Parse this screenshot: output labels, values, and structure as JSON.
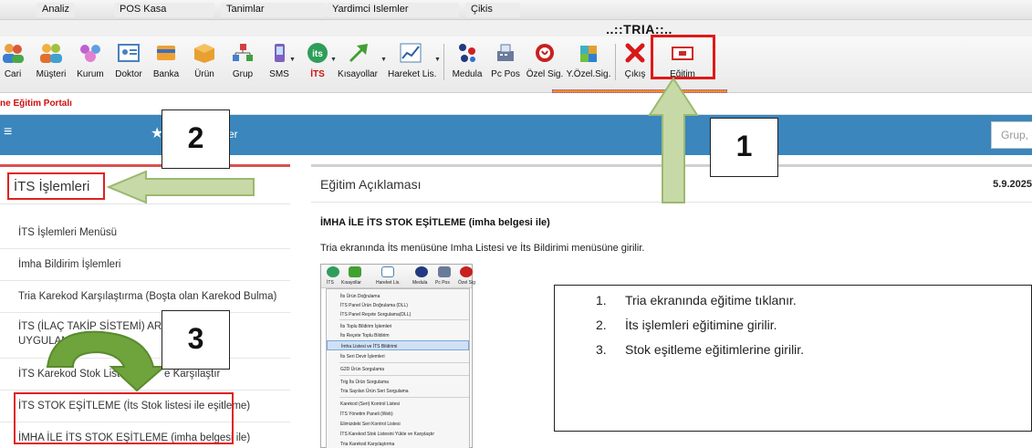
{
  "menubar": {
    "items": [
      "Analiz",
      "POS Kasa",
      "Tanimlar",
      "Yardimci Islemler",
      "Çikis"
    ]
  },
  "app_title": "..::TRIA::..",
  "toolbar": {
    "buttons": [
      {
        "label": "Cari",
        "icon": "users-icon"
      },
      {
        "label": "Müşteri",
        "icon": "customers-icon"
      },
      {
        "label": "Kurum",
        "icon": "institution-icon"
      },
      {
        "label": "Doktor",
        "icon": "doctor-icon"
      },
      {
        "label": "Banka",
        "icon": "bank-icon"
      },
      {
        "label": "Ürün",
        "icon": "box-icon"
      },
      {
        "label": "Grup",
        "icon": "group-icon"
      },
      {
        "label": "SMS",
        "icon": "phone-icon"
      },
      {
        "label": "İTS",
        "icon": "its-icon"
      },
      {
        "label": "Kısayollar",
        "icon": "arrow-icon"
      },
      {
        "label": "Hareket Lis.",
        "icon": "chart-icon"
      },
      {
        "label": "Medula",
        "icon": "molecule-icon"
      },
      {
        "label": "Pc Pos",
        "icon": "pos-icon"
      },
      {
        "label": "Özel Sig.",
        "icon": "insurance-icon"
      },
      {
        "label": "Y.Özel.Sig.",
        "icon": "puzzle-icon"
      },
      {
        "label": "Çıkış",
        "icon": "close-icon"
      },
      {
        "label": "Eğitim",
        "icon": "video-icon"
      }
    ]
  },
  "portal_label": "ne Eğitim Portalı",
  "header": {
    "text": "er",
    "search_placeholder": "Grup, e"
  },
  "left": {
    "title": "İTS İşlemleri",
    "items": [
      "İTS İşlemleri Menüsü",
      "İmha Bildirim İşlemleri",
      "Tria Karekod Karşılaştırma (Boşta olan Karekod Bulma)",
      "İTS  (İLAÇ TAKİP SİSTEMİ) ARADA",
      "UYGULANA",
      "İTS Karekod Stok Listesi",
      "e Karşılaştır",
      "İTS STOK EŞİTLEME (İts Stok listesi ile eşitleme)",
      "İMHA İLE İTS STOK EŞİTLEME (imha belgesi ile)"
    ]
  },
  "right": {
    "title": "Eğitim Açıklaması",
    "date": "5.9.2025",
    "heading": "İMHA İLE  İTS STOK EŞİTLEME (imha belgesi ile)",
    "desc": "Tria ekranında İts menüsüne Imha Listesi ve İts Bildirimi menüsüne girilir."
  },
  "embed": {
    "toolbar_labels": [
      "İTS",
      "Kısayollar",
      "Hareket Lis.",
      "Medula",
      "Pc Pos",
      "Özel Sig"
    ],
    "menu_items": [
      "İts Ürün Doğrulama",
      "İTS Panel Ürün Doğrulama (DLL)",
      "İTS Panel Reçete Sorgulama(DLL)",
      "İts Toplu Bildirim İşlemleri",
      "İts Reçete Toplu Bildirim",
      "İmha Listesi ve İTS Bildirimi",
      "İts Seri Devir İşlemleri",
      "G2D Ürün Sorgulama",
      "Trig İts Ürün Sorgulama",
      "Tria Sayılan Ürün Seri Sorgulama",
      "Karekod (Seri) Kontrol Listesi",
      "İTS Yönetim Paneli (Web)",
      "Elimizdeki Seri Kontrol Listesi",
      "İTS Karekod Stok Listesini Yükle ve Karşılaştır",
      "Tria Karekod Karşılaştırma"
    ]
  },
  "callout": {
    "steps": [
      {
        "num": "1.",
        "text": "Tria ekranında eğitime tıklanır."
      },
      {
        "num": "2.",
        "text": "İts işlemleri eğitimine girilir."
      },
      {
        "num": "3.",
        "text": "Stok eşitleme eğitimlerine girilir."
      }
    ]
  },
  "markers": [
    "1",
    "2",
    "3"
  ],
  "colors": {
    "header_blue": "#3a86bd",
    "highlight_red": "#e02020",
    "arrow_green": "#c7d9a6",
    "arrow_border": "#9cb870"
  }
}
